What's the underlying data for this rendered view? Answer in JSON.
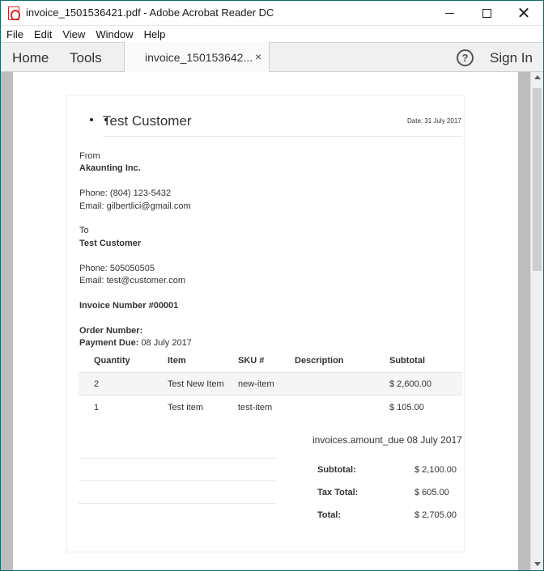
{
  "window": {
    "title": "invoice_1501536421.pdf - Adobe Acrobat Reader DC"
  },
  "menu": {
    "items": [
      "File",
      "Edit",
      "View",
      "Window",
      "Help"
    ]
  },
  "toolbar": {
    "home": "Home",
    "tools": "Tools",
    "tab_label": "invoice_150153642...",
    "tab_close": "×",
    "help": "?",
    "sign_in": "Sign In"
  },
  "invoice": {
    "customer_title": "Test Customer",
    "date": "Date: 31 July 2017",
    "from_label": "From",
    "from_company": "Akaunting Inc.",
    "from_phone": "Phone: (804) 123-5432",
    "from_email": "Email: gilbertlici@gmail.com",
    "to_label": "To",
    "to_name": "Test Customer",
    "to_phone": "Phone: 505050505",
    "to_email": "Email: test@customer.com",
    "invoice_number": "Invoice Number #00001",
    "order_number_label": "Order Number:",
    "payment_due_label": "Payment Due:",
    "payment_due_value": "08 July 2017",
    "columns": [
      "Quantity",
      "Item",
      "SKU #",
      "Description",
      "Subtotal"
    ],
    "rows": [
      {
        "quantity": "2",
        "item": "Test New Item",
        "sku": "new-item",
        "description": "",
        "subtotal": "$ 2,600.00"
      },
      {
        "quantity": "1",
        "item": "Test item",
        "sku": "test-item",
        "description": "",
        "subtotal": "$ 105.00"
      }
    ],
    "amount_due": "invoices.amount_due 08 July 2017",
    "totals": {
      "subtotal_label": "Subtotal:",
      "subtotal_value": "$ 2,100.00",
      "tax_label": "Tax Total:",
      "tax_value": "$ 605.00",
      "total_label": "Total:",
      "total_value": "$ 2,705.00"
    }
  }
}
